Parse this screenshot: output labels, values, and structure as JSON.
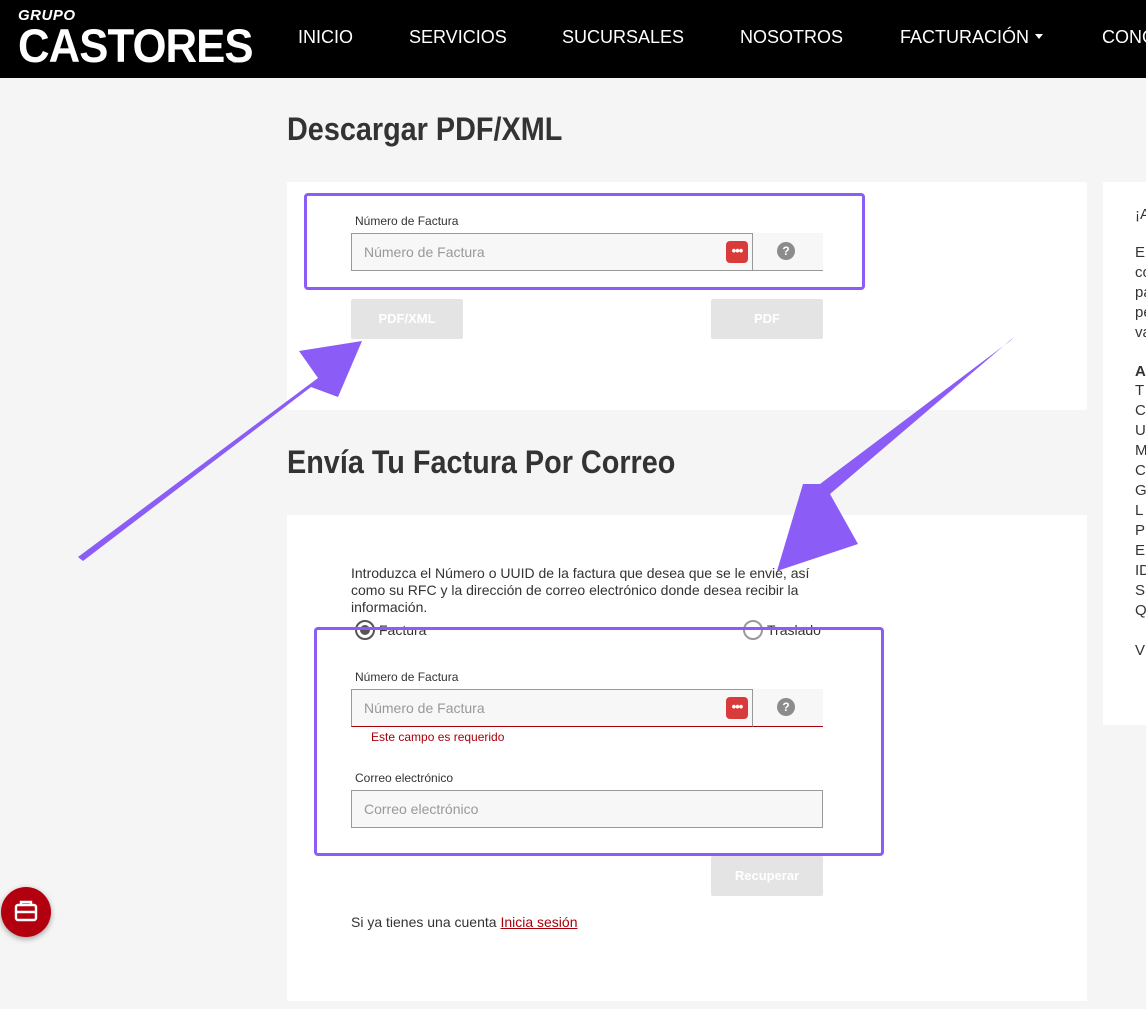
{
  "nav": {
    "logo_small": "GRUPO",
    "logo_big": "CASTORES",
    "logo_reg": "®",
    "items": [
      "INICIO",
      "SERVICIOS",
      "SUCURSALES",
      "NOSOTROS",
      "FACTURACIÓN",
      "CONO"
    ]
  },
  "download": {
    "title": "Descargar PDF/XML",
    "invoice_label": "Número de Factura",
    "invoice_placeholder": "Número de Factura",
    "help_icon": "?",
    "pdfxml_button": "PDF/XML",
    "pdf_button": "PDF"
  },
  "email": {
    "title": "Envía Tu Factura Por Correo",
    "description": "Introduzca el Número o UUID de la factura que desea que se le envie, así como su RFC y la dirección de correo electrónico donde desea recibir la información.",
    "radio_factura": "Factura",
    "radio_traslado": "Traslado",
    "invoice_label": "Número de Factura",
    "invoice_placeholder": "Número de Factura",
    "invoice_error": "Este campo es requerido",
    "help_icon": "?",
    "email_label": "Correo electrónico",
    "email_placeholder": "Correo electrónico",
    "recover_button": "Recuperar",
    "login_prefix": "Si ya tienes una cuenta",
    "login_link": "Inicia sesión"
  },
  "sidebar": {
    "lines": [
      "¡A",
      "E",
      "co",
      "pa",
      "pe",
      "va",
      "A",
      "T",
      "C",
      "U",
      "M",
      "C",
      "G",
      "L",
      "P",
      "E",
      "ID",
      "S",
      "Q",
      "V"
    ]
  },
  "icons": {
    "password_icon": "password-dots-icon",
    "help_icon": "question-circle-icon",
    "fab_icon": "briefcase-icon"
  },
  "colors": {
    "brand_red": "#b3000f",
    "error_red": "#a8000b",
    "highlight": "#8b5cf6",
    "nav_bg": "#000000"
  }
}
